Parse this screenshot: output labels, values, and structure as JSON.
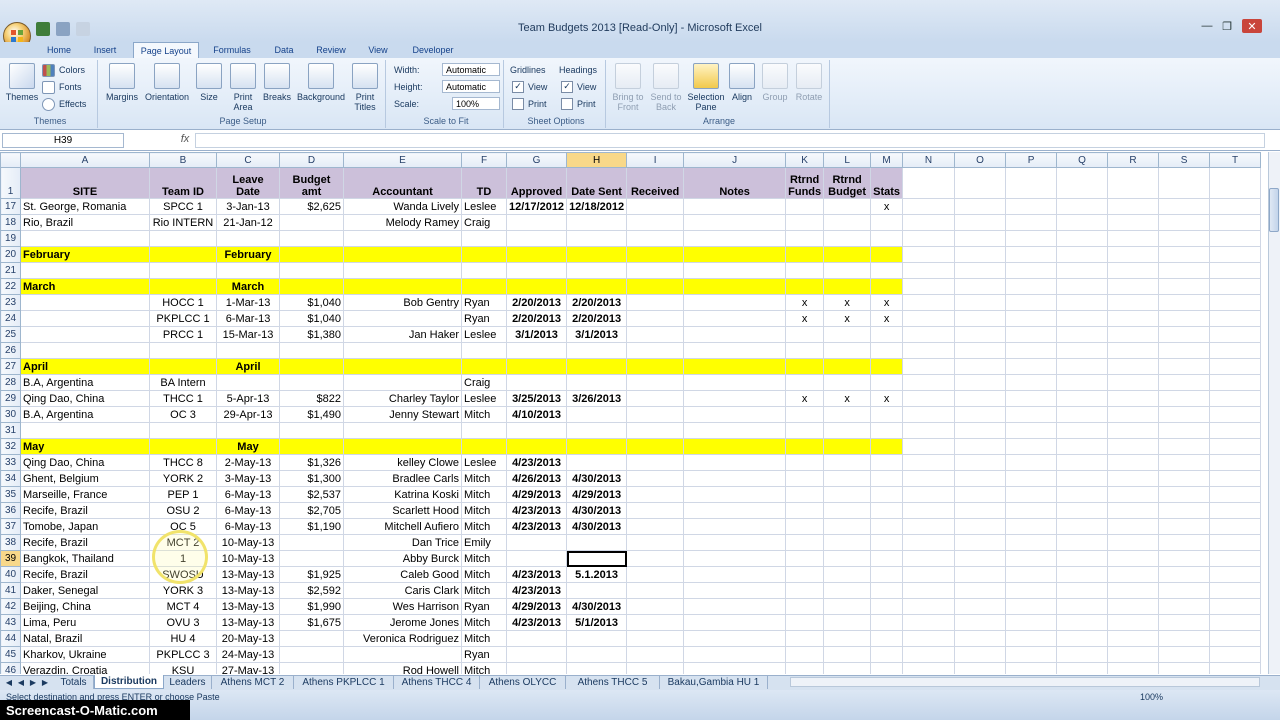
{
  "window": {
    "title": "Team Budgets 2013  [Read-Only] - Microsoft Excel"
  },
  "ribbon_tabs": [
    "Home",
    "Insert",
    "Page Layout",
    "Formulas",
    "Data",
    "Review",
    "View",
    "Developer"
  ],
  "ribbon": {
    "themes": {
      "themes": "Themes",
      "colors": "Colors",
      "fonts": "Fonts",
      "effects": "Effects",
      "group": "Themes"
    },
    "page_setup": {
      "margins": "Margins",
      "orientation": "Orientation",
      "size": "Size",
      "print_area": "Print Area",
      "breaks": "Breaks",
      "background": "Background",
      "print_titles": "Print Titles",
      "group": "Page Setup"
    },
    "scale": {
      "width_label": "Width:",
      "width_value": "Automatic",
      "height_label": "Height:",
      "height_value": "Automatic",
      "scale_label": "Scale:",
      "scale_value": "100%",
      "group": "Scale to Fit"
    },
    "sheet_options": {
      "gridlines": "Gridlines",
      "headings": "Headings",
      "view": "View",
      "print": "Print",
      "group": "Sheet Options"
    },
    "arrange": {
      "bring_to_front": "Bring to Front",
      "send_to_back": "Send to Back",
      "selection_pane": "Selection Pane",
      "align": "Align",
      "group_btn": "Group",
      "rotate": "Rotate",
      "group": "Arrange"
    }
  },
  "formula_bar": {
    "name_box": "H39",
    "fx": "fx",
    "formula": ""
  },
  "columns": [
    "A",
    "B",
    "C",
    "D",
    "E",
    "F",
    "G",
    "H",
    "I",
    "J",
    "K",
    "L",
    "M",
    "N",
    "O",
    "P",
    "Q",
    "R",
    "S",
    "T"
  ],
  "header_row": {
    "num": "1",
    "cells": [
      "SITE",
      "Team ID",
      "Leave Date",
      "Budget amt",
      "Accountant",
      "TD",
      "Approved",
      "Date Sent",
      "Received",
      "Notes",
      "Rtrnd Funds",
      "Rtrnd Budget",
      "Stats"
    ]
  },
  "rows": [
    {
      "num": "17",
      "cells": [
        "St. George, Romania",
        "SPCC 1",
        "3-Jan-13",
        "$2,625",
        "Wanda Lively",
        "Leslee",
        "12/17/2012",
        "12/18/2012",
        "",
        "",
        "",
        "",
        "x"
      ]
    },
    {
      "num": "18",
      "cells": [
        "Rio, Brazil",
        "Rio INTERN",
        "21-Jan-12",
        "",
        "Melody Ramey",
        "Craig",
        "",
        "",
        "",
        "",
        "",
        "",
        ""
      ]
    },
    {
      "num": "19",
      "cells": [
        "",
        "",
        "",
        "",
        "",
        "",
        "",
        "",
        "",
        "",
        "",
        "",
        ""
      ]
    },
    {
      "num": "20",
      "month": true,
      "cells": [
        "February",
        "",
        "February",
        "",
        "",
        "",
        "",
        "",
        "",
        "",
        "",
        "",
        ""
      ]
    },
    {
      "num": "21",
      "cells": [
        "",
        "",
        "",
        "",
        "",
        "",
        "",
        "",
        "",
        "",
        "",
        "",
        ""
      ]
    },
    {
      "num": "22",
      "month": true,
      "cells": [
        "March",
        "",
        "March",
        "",
        "",
        "",
        "",
        "",
        "",
        "",
        "",
        "",
        ""
      ]
    },
    {
      "num": "23",
      "cells": [
        "",
        "HOCC 1",
        "1-Mar-13",
        "$1,040",
        "Bob Gentry",
        "Ryan",
        "2/20/2013",
        "2/20/2013",
        "",
        "",
        "x",
        "x",
        "x"
      ]
    },
    {
      "num": "24",
      "cells": [
        "",
        "PKPLCC 1",
        "6-Mar-13",
        "$1,040",
        "",
        "Ryan",
        "2/20/2013",
        "2/20/2013",
        "",
        "",
        "x",
        "x",
        "x"
      ]
    },
    {
      "num": "25",
      "cells": [
        "",
        "PRCC 1",
        "15-Mar-13",
        "$1,380",
        "Jan Haker",
        "Leslee",
        "3/1/2013",
        "3/1/2013",
        "",
        "",
        "",
        "",
        ""
      ]
    },
    {
      "num": "26",
      "cells": [
        "",
        "",
        "",
        "",
        "",
        "",
        "",
        "",
        "",
        "",
        "",
        "",
        ""
      ]
    },
    {
      "num": "27",
      "month": true,
      "cells": [
        "April",
        "",
        "April",
        "",
        "",
        "",
        "",
        "",
        "",
        "",
        "",
        "",
        ""
      ]
    },
    {
      "num": "28",
      "cells": [
        "B.A, Argentina",
        "BA Intern",
        "",
        "",
        "",
        "Craig",
        "",
        "",
        "",
        "",
        "",
        "",
        ""
      ]
    },
    {
      "num": "29",
      "cells": [
        "Qing Dao, China",
        "THCC 1",
        "5-Apr-13",
        "$822",
        "Charley Taylor",
        "Leslee",
        "3/25/2013",
        "3/26/2013",
        "",
        "",
        "x",
        "x",
        "x"
      ]
    },
    {
      "num": "30",
      "cells": [
        "B.A, Argentina",
        "OC 3",
        "29-Apr-13",
        "$1,490",
        "Jenny Stewart",
        "Mitch",
        "4/10/2013",
        "",
        "",
        "",
        "",
        "",
        ""
      ]
    },
    {
      "num": "31",
      "cells": [
        "",
        "",
        "",
        "",
        "",
        "",
        "",
        "",
        "",
        "",
        "",
        "",
        ""
      ]
    },
    {
      "num": "32",
      "month": true,
      "cells": [
        "May",
        "",
        "May",
        "",
        "",
        "",
        "",
        "",
        "",
        "",
        "",
        "",
        ""
      ]
    },
    {
      "num": "33",
      "cells": [
        "Qing Dao, China",
        "THCC 8",
        "2-May-13",
        "$1,326",
        "kelley Clowe",
        "Leslee",
        "4/23/2013",
        "",
        "",
        "",
        "",
        "",
        ""
      ]
    },
    {
      "num": "34",
      "cells": [
        "Ghent, Belgium",
        "YORK 2",
        "3-May-13",
        "$1,300",
        "Bradlee Carls",
        "Mitch",
        "4/26/2013",
        "4/30/2013",
        "",
        "",
        "",
        "",
        ""
      ]
    },
    {
      "num": "35",
      "cells": [
        "Marseille, France",
        "PEP 1",
        "6-May-13",
        "$2,537",
        "Katrina Koski",
        "Mitch",
        "4/29/2013",
        "4/29/2013",
        "",
        "",
        "",
        "",
        ""
      ]
    },
    {
      "num": "36",
      "cells": [
        "Recife, Brazil",
        "OSU 2",
        "6-May-13",
        "$2,705",
        "Scarlett Hood",
        "Mitch",
        "4/23/2013",
        "4/30/2013",
        "",
        "",
        "",
        "",
        ""
      ]
    },
    {
      "num": "37",
      "cells": [
        "Tomobe, Japan",
        "OC 5",
        "6-May-13",
        "$1,190",
        "Mitchell Aufiero",
        "Mitch",
        "4/23/2013",
        "4/30/2013",
        "",
        "",
        "",
        "",
        ""
      ]
    },
    {
      "num": "38",
      "cells": [
        "Recife, Brazil",
        "MCT 2",
        "10-May-13",
        "",
        "Dan Trice",
        "Emily",
        "",
        "",
        "",
        "",
        "",
        "",
        ""
      ]
    },
    {
      "num": "39",
      "cells": [
        "Bangkok, Thailand",
        "1",
        "10-May-13",
        "",
        "Abby Burck",
        "Mitch",
        "",
        "",
        "",
        "",
        "",
        "",
        ""
      ]
    },
    {
      "num": "40",
      "cells": [
        "Recife, Brazil",
        "SWOSU",
        "13-May-13",
        "$1,925",
        "Caleb Good",
        "Mitch",
        "4/23/2013",
        "5.1.2013",
        "",
        "",
        "",
        "",
        ""
      ]
    },
    {
      "num": "41",
      "cells": [
        "Daker, Senegal",
        "YORK 3",
        "13-May-13",
        "$2,592",
        "Caris Clark",
        "Mitch",
        "4/23/2013",
        "",
        "",
        "",
        "",
        "",
        ""
      ]
    },
    {
      "num": "42",
      "cells": [
        "Beijing, China",
        "MCT 4",
        "13-May-13",
        "$1,990",
        "Wes Harrison",
        "Ryan",
        "4/29/2013",
        "4/30/2013",
        "",
        "",
        "",
        "",
        ""
      ]
    },
    {
      "num": "43",
      "cells": [
        "Lima, Peru",
        "OVU 3",
        "13-May-13",
        "$1,675",
        "Jerome Jones",
        "Mitch",
        "4/23/2013",
        "5/1/2013",
        "",
        "",
        "",
        "",
        ""
      ]
    },
    {
      "num": "44",
      "cells": [
        "Natal, Brazil",
        "HU 4",
        "20-May-13",
        "",
        "Veronica Rodriguez",
        "Mitch",
        "",
        "",
        "",
        "",
        "",
        "",
        ""
      ]
    },
    {
      "num": "45",
      "cells": [
        "Kharkov, Ukraine",
        "PKPLCC 3",
        "24-May-13",
        "",
        "",
        "Ryan",
        "",
        "",
        "",
        "",
        "",
        "",
        ""
      ]
    },
    {
      "num": "46",
      "cells": [
        "Verazdin, Croatia",
        "KSU",
        "27-May-13",
        "",
        "Rod Howell",
        "Mitch",
        "",
        "",
        "",
        "",
        "",
        "",
        ""
      ]
    }
  ],
  "active_cell": {
    "row": "39",
    "col": "H"
  },
  "sheet_tabs": [
    "Totals",
    "Distribution",
    "Leaders",
    "Athens MCT 2",
    "Athens PKPLCC 1",
    "Athens THCC 4",
    "Athens OLYCC",
    "Athens THCC 5",
    "Bakau,Gambia HU 1"
  ],
  "active_sheet": "Distribution",
  "status": {
    "text": "Select destination and press ENTER or choose Paste",
    "zoom": "100%"
  },
  "watermark": "Screencast-O-Matic.com"
}
